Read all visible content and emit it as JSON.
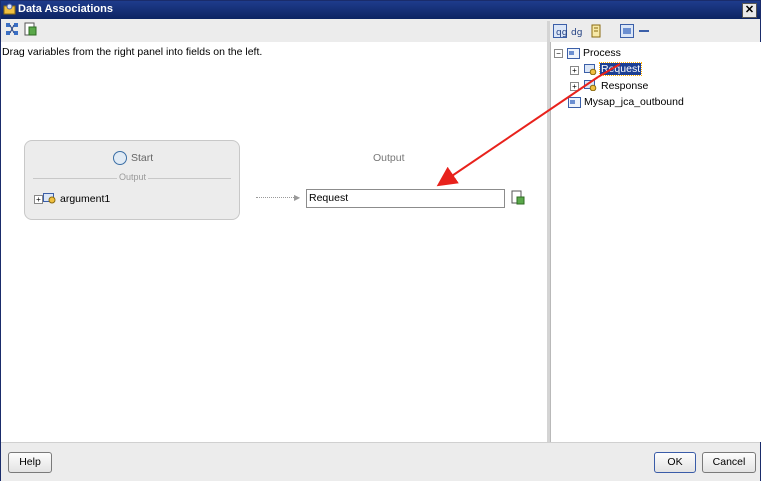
{
  "window": {
    "title": "Data Associations",
    "close_glyph": "✕"
  },
  "left": {
    "hint": "Drag variables from the right panel into fields on the left.",
    "start_label": "Start",
    "output_separator": "Output",
    "argument_label": "argument1",
    "output_heading": "Output",
    "output_value": "Request"
  },
  "tree": {
    "root": "Process",
    "items": [
      {
        "label": "Request",
        "selected": true
      },
      {
        "label": "Response",
        "selected": false
      },
      {
        "label": "Mysap_jca_outbound",
        "selected": false
      }
    ]
  },
  "buttons": {
    "help": "Help",
    "ok": "OK",
    "cancel": "Cancel"
  },
  "colors": {
    "arrow": "#e8221c",
    "title_bar": "#0c2462",
    "selection": "#1c3f94"
  },
  "icons": [
    "data-associations-icon",
    "expression-icon",
    "variable-icon",
    "close-icon",
    "expand-icon",
    "tree-icon"
  ]
}
